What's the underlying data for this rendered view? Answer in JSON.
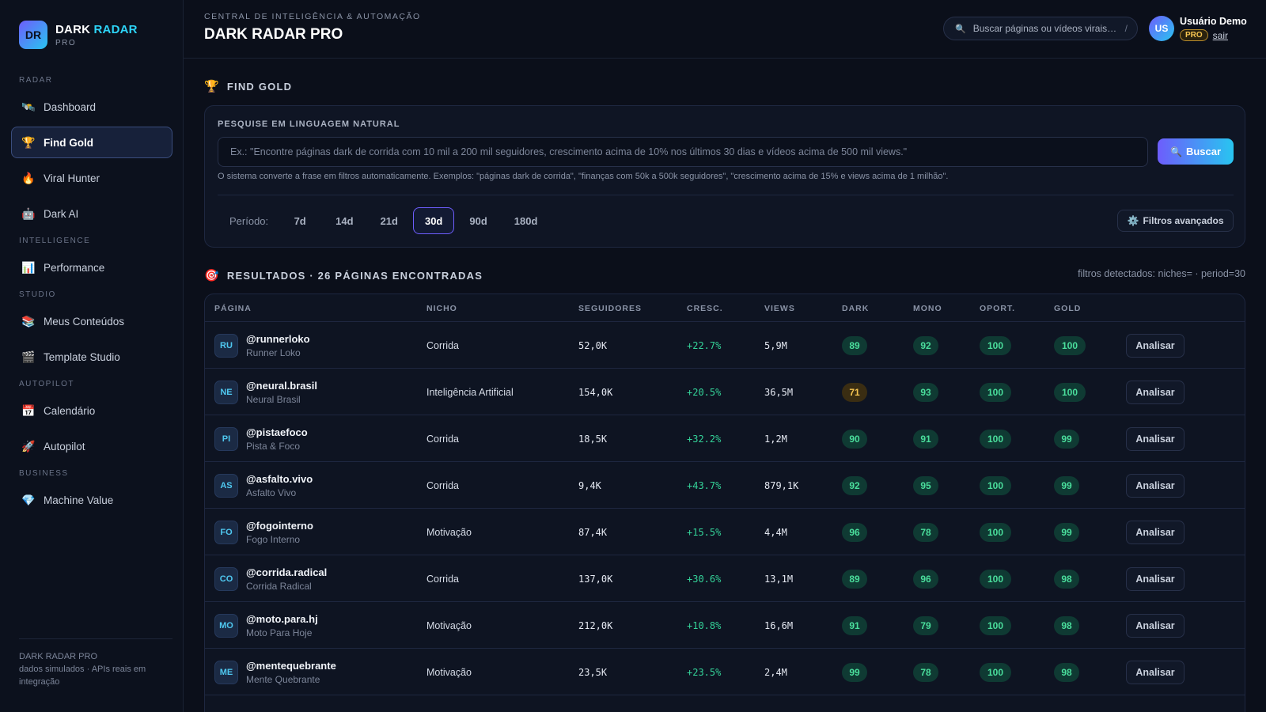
{
  "brand": {
    "logo": "DR",
    "name_part1": "DARK",
    "name_part2": "RADAR",
    "sub": "PRO"
  },
  "sidebar": {
    "sections": [
      {
        "title": "RADAR",
        "items": [
          {
            "icon": "🛰️",
            "icon_name": "satellite-icon",
            "label": "Dashboard"
          },
          {
            "icon": "🏆",
            "icon_name": "trophy-icon",
            "label": "Find Gold",
            "active": true
          },
          {
            "icon": "🔥",
            "icon_name": "fire-icon",
            "label": "Viral Hunter"
          },
          {
            "icon": "🤖",
            "icon_name": "robot-icon",
            "label": "Dark AI"
          }
        ]
      },
      {
        "title": "INTELLIGENCE",
        "items": [
          {
            "icon": "📊",
            "icon_name": "bar-chart-icon",
            "label": "Performance"
          }
        ]
      },
      {
        "title": "STUDIO",
        "items": [
          {
            "icon": "📚",
            "icon_name": "books-icon",
            "label": "Meus Conteúdos"
          },
          {
            "icon": "🎬",
            "icon_name": "clapperboard-icon",
            "label": "Template Studio"
          }
        ]
      },
      {
        "title": "AUTOPILOT",
        "items": [
          {
            "icon": "📅",
            "icon_name": "calendar-icon",
            "label": "Calendário"
          },
          {
            "icon": "🚀",
            "icon_name": "rocket-icon",
            "label": "Autopilot"
          }
        ]
      },
      {
        "title": "BUSINESS",
        "items": [
          {
            "icon": "💎",
            "icon_name": "gem-icon",
            "label": "Machine Value"
          }
        ]
      }
    ],
    "footer_line1": "DARK RADAR PRO",
    "footer_line2": "dados simulados · APIs reais em",
    "footer_line3": "integração"
  },
  "header": {
    "kicker": "CENTRAL DE INTELIGÊNCIA & AUTOMAÇÃO",
    "title": "DARK RADAR PRO",
    "search_placeholder": "Buscar páginas ou vídeos virais…",
    "search_shortcut": "/",
    "user_initials": "US",
    "user_name": "Usuário Demo",
    "plan_badge": "PRO",
    "logout_label": "sair"
  },
  "find_gold": {
    "icon": "🏆",
    "title": "FIND GOLD",
    "label": "PESQUISE EM LINGUAGEM NATURAL",
    "input_placeholder": "Ex.: \"Encontre páginas dark de corrida com 10 mil a 200 mil seguidores, crescimento acima de 10% nos últimos 30 dias e vídeos acima de 500 mil views.\"",
    "search_button": "Buscar",
    "hint": "O sistema converte a frase em filtros automaticamente. Exemplos: \"páginas dark de corrida\", \"finanças com 50k a 500k seguidores\", \"crescimento acima de 15% e views acima de 1 milhão\".",
    "period_label": "Período:",
    "periods": [
      "7d",
      "14d",
      "21d",
      "30d",
      "90d",
      "180d"
    ],
    "active_period": "30d",
    "advanced_filters": "Filtros avançados"
  },
  "results": {
    "icon": "🎯",
    "title": "RESULTADOS · 26 PÁGINAS ENCONTRADAS",
    "meta": "filtros detectados: niches= · period=30",
    "columns": [
      "PÁGINA",
      "NICHO",
      "SEGUIDORES",
      "CRESC.",
      "VIEWS",
      "DARK",
      "MONO",
      "OPORT.",
      "GOLD"
    ],
    "action_label": "Analisar",
    "rows": [
      {
        "initials": "RU",
        "handle": "@runnerloko",
        "name": "Runner Loko",
        "niche": "Corrida",
        "followers": "52,0K",
        "growth": "+22.7%",
        "views": "5,9M",
        "dark": 89,
        "mono": 92,
        "oport": 100,
        "gold": 100
      },
      {
        "initials": "NE",
        "handle": "@neural.brasil",
        "name": "Neural Brasil",
        "niche": "Inteligência Artificial",
        "followers": "154,0K",
        "growth": "+20.5%",
        "views": "36,5M",
        "dark": 71,
        "mono": 93,
        "oport": 100,
        "gold": 100
      },
      {
        "initials": "PI",
        "handle": "@pistaefoco",
        "name": "Pista & Foco",
        "niche": "Corrida",
        "followers": "18,5K",
        "growth": "+32.2%",
        "views": "1,2M",
        "dark": 90,
        "mono": 91,
        "oport": 100,
        "gold": 99
      },
      {
        "initials": "AS",
        "handle": "@asfalto.vivo",
        "name": "Asfalto Vivo",
        "niche": "Corrida",
        "followers": "9,4K",
        "growth": "+43.7%",
        "views": "879,1K",
        "dark": 92,
        "mono": 95,
        "oport": 100,
        "gold": 99
      },
      {
        "initials": "FO",
        "handle": "@fogointerno",
        "name": "Fogo Interno",
        "niche": "Motivação",
        "followers": "87,4K",
        "growth": "+15.5%",
        "views": "4,4M",
        "dark": 96,
        "mono": 78,
        "oport": 100,
        "gold": 99
      },
      {
        "initials": "CO",
        "handle": "@corrida.radical",
        "name": "Corrida Radical",
        "niche": "Corrida",
        "followers": "137,0K",
        "growth": "+30.6%",
        "views": "13,1M",
        "dark": 89,
        "mono": 96,
        "oport": 100,
        "gold": 98
      },
      {
        "initials": "MO",
        "handle": "@moto.para.hj",
        "name": "Moto Para Hoje",
        "niche": "Motivação",
        "followers": "212,0K",
        "growth": "+10.8%",
        "views": "16,6M",
        "dark": 91,
        "mono": 79,
        "oport": 100,
        "gold": 98
      },
      {
        "initials": "ME",
        "handle": "@mentequebrante",
        "name": "Mente Quebrante",
        "niche": "Motivação",
        "followers": "23,5K",
        "growth": "+23.5%",
        "views": "2,4M",
        "dark": 99,
        "mono": 78,
        "oport": 100,
        "gold": 98
      }
    ]
  },
  "colors": {
    "accent_start": "#6d5dfc",
    "accent_end": "#28c5f0",
    "success": "#4ade9c",
    "warning": "#f5c451",
    "background": "#0b0f1a"
  }
}
